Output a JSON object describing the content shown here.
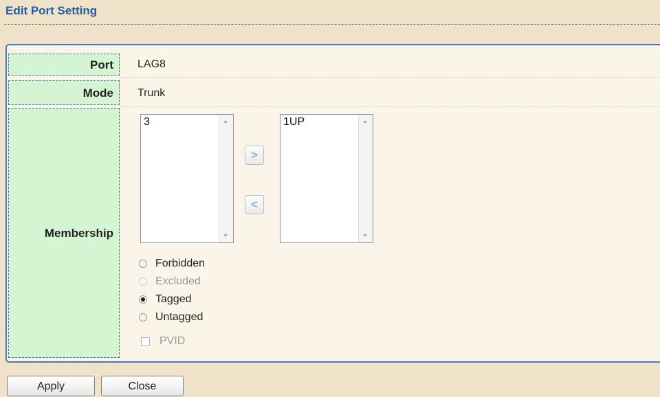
{
  "title": "Edit Port Setting",
  "form": {
    "port_label": "Port",
    "port_value": "LAG8",
    "mode_label": "Mode",
    "mode_value": "Trunk",
    "membership_label": "Membership"
  },
  "membership": {
    "available_list": [
      "3"
    ],
    "selected_list": [
      "1UP"
    ],
    "add_arrow": ">",
    "remove_arrow": "<",
    "options": [
      {
        "label": "Forbidden",
        "checked": false,
        "disabled": false
      },
      {
        "label": "Excluded",
        "checked": false,
        "disabled": true
      },
      {
        "label": "Tagged",
        "checked": true,
        "disabled": false
      },
      {
        "label": "Untagged",
        "checked": false,
        "disabled": false
      }
    ],
    "pvid_label": "PVID",
    "pvid_checked": false
  },
  "buttons": {
    "apply": "Apply",
    "close": "Close"
  },
  "colors": {
    "title": "#1f5ea8",
    "background": "#efe2c9",
    "panel": "#faf5e8",
    "label_cell": "#d4f5d2",
    "panel_border": "#4a78b6"
  }
}
